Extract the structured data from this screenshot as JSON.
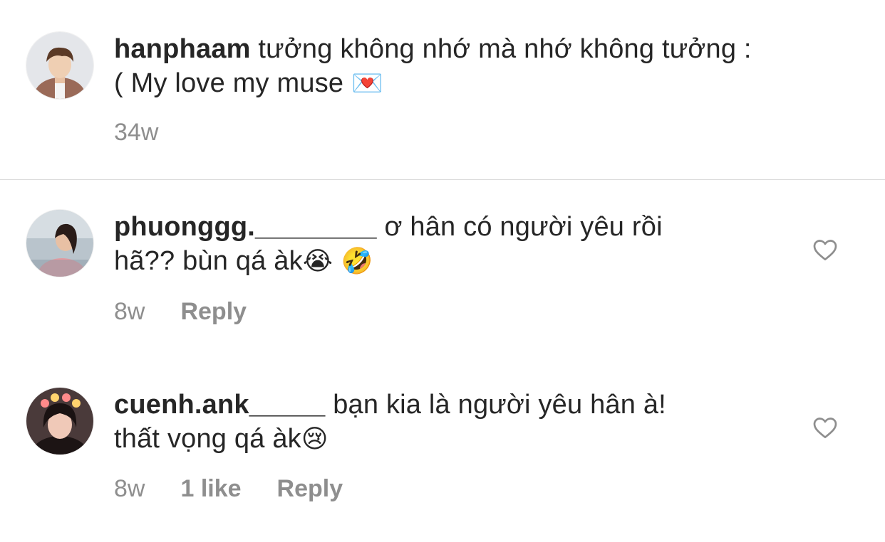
{
  "caption": {
    "username": "hanphaam",
    "text_line1": "tưởng không nhớ mà nhớ không tưởng :",
    "text_line2": "( My love my muse",
    "emoji": "💌",
    "time": "34w"
  },
  "comments": [
    {
      "username": "phuonggg.________",
      "text_line1": "ơ hân có người yêu rồi",
      "text_line2": "hã?? bùn qá àk",
      "emoji": "😭 🤣",
      "time": "8w",
      "reply_label": "Reply"
    },
    {
      "username": "cuenh.ank_____",
      "text_line1": "bạn kia là người yêu hân à!",
      "text_line2": "thất vọng qá àk",
      "emoji": "😢",
      "time": "8w",
      "likes_label": "1 like",
      "reply_label": "Reply"
    }
  ],
  "colors": {
    "text": "#262626",
    "muted": "#8e8e8e",
    "divider": "#dbdbdb"
  }
}
